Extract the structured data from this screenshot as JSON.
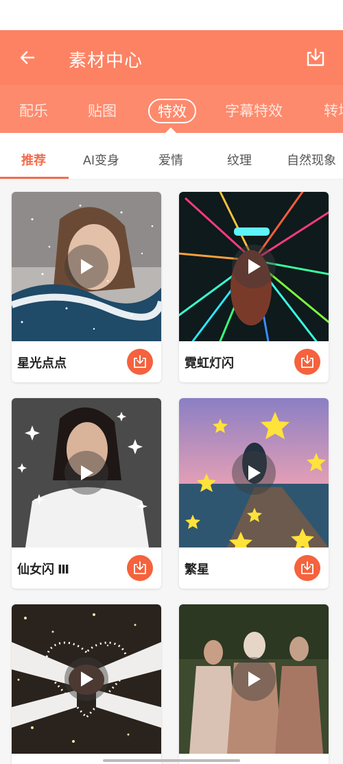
{
  "header": {
    "title": "素材中心",
    "back_icon": "arrow-left-icon",
    "download_icon": "download-icon",
    "accent": "#fd8263"
  },
  "categories": [
    "配乐",
    "贴图",
    "特效",
    "字幕特效",
    "转场"
  ],
  "active_category": "特效",
  "subtabs": [
    "推荐",
    "AI变身",
    "爱情",
    "纹理",
    "自然现象"
  ],
  "active_subtab": "推荐",
  "cards": [
    {
      "title": "星光点点"
    },
    {
      "title": "霓虹灯闪"
    },
    {
      "title": "仙女闪 Ⅲ"
    },
    {
      "title": "繁星"
    },
    {
      "title": ""
    },
    {
      "title": ""
    }
  ]
}
